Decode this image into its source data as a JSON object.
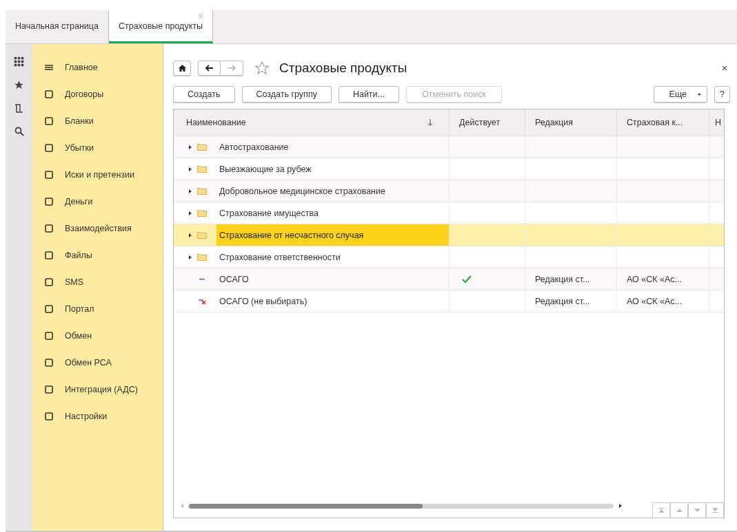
{
  "tabs": [
    {
      "label": "Начальная страница",
      "selected": false,
      "closable": false
    },
    {
      "label": "Страховые продукты",
      "selected": true,
      "closable": true
    }
  ],
  "sidebar": {
    "items": [
      {
        "label": "Главное"
      },
      {
        "label": "Договоры"
      },
      {
        "label": "Бланки"
      },
      {
        "label": "Убытки"
      },
      {
        "label": "Иски и претензии"
      },
      {
        "label": "Деньги"
      },
      {
        "label": "Взаимодействия"
      },
      {
        "label": "Файлы"
      },
      {
        "label": "SMS"
      },
      {
        "label": "Портал"
      },
      {
        "label": "Обмен"
      },
      {
        "label": "Обмен РСА"
      },
      {
        "label": "Интеграция (АДС)"
      },
      {
        "label": "Настройки"
      }
    ]
  },
  "form": {
    "title": "Страховые продукты",
    "buttons": [
      {
        "label": "Создать",
        "disabled": false
      },
      {
        "label": "Создать группу",
        "disabled": false
      },
      {
        "label": "Найти...",
        "disabled": false
      },
      {
        "label": "Отменить поиск",
        "disabled": true
      }
    ],
    "more_button": "Еще",
    "help_button": "?",
    "table": {
      "columns": [
        "Наименование",
        "Действует",
        "Редакция",
        "Страховая к...",
        "Н"
      ],
      "rows": [
        {
          "kind": "folder",
          "name": "Автострахование",
          "selected": false
        },
        {
          "kind": "folder",
          "name": "Выезжающие за рубеж",
          "selected": false
        },
        {
          "kind": "folder",
          "name": "Добровольное медицинское страхование",
          "selected": false
        },
        {
          "kind": "folder",
          "name": "Страхование имущества",
          "selected": false
        },
        {
          "kind": "folder",
          "name": "Страхование от несчастного случая",
          "selected": true
        },
        {
          "kind": "folder",
          "name": "Страхование ответственности",
          "selected": false
        },
        {
          "kind": "item",
          "name": "ОСАГО",
          "selected": false,
          "active": true,
          "edition": "Редакция ст...",
          "insurer": "АО «СК «Ас..."
        },
        {
          "kind": "deleted",
          "name": "ОСАГО (не выбирать)",
          "selected": false,
          "active": false,
          "edition": "Редакция ст...",
          "insurer": "АО «СК «Ас..."
        }
      ]
    }
  }
}
